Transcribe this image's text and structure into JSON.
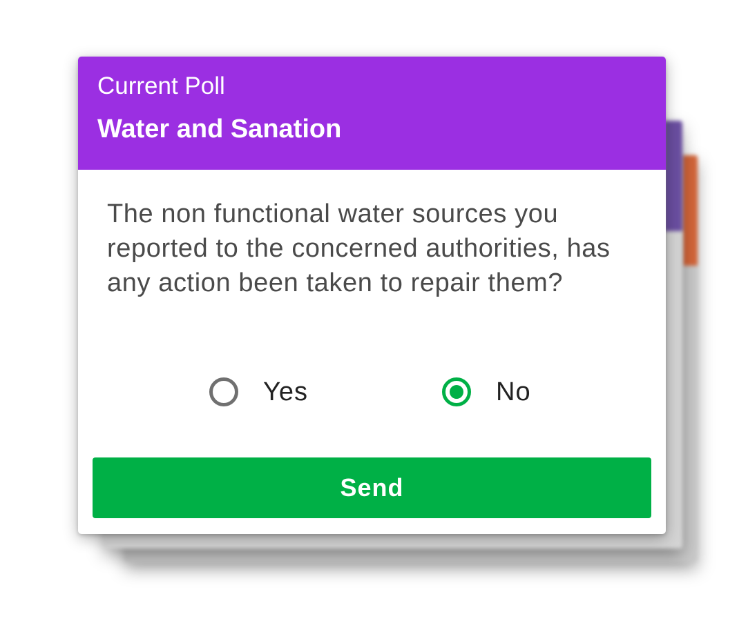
{
  "colors": {
    "header_bg": "#9b2fe2",
    "accent_green": "#00b046",
    "radio_unchecked": "#707070",
    "back_card_1_edge": "#6a4ea0",
    "back_card_2_edge": "#d4663a"
  },
  "poll": {
    "subtitle": "Current Poll",
    "title": "Water and Sanation",
    "question": "The non functional water sources you reported to the concerned authorities, has any action been taken to repair them?",
    "options": [
      {
        "label": "Yes",
        "selected": false
      },
      {
        "label": "No",
        "selected": true
      }
    ],
    "send_label": "Send"
  }
}
